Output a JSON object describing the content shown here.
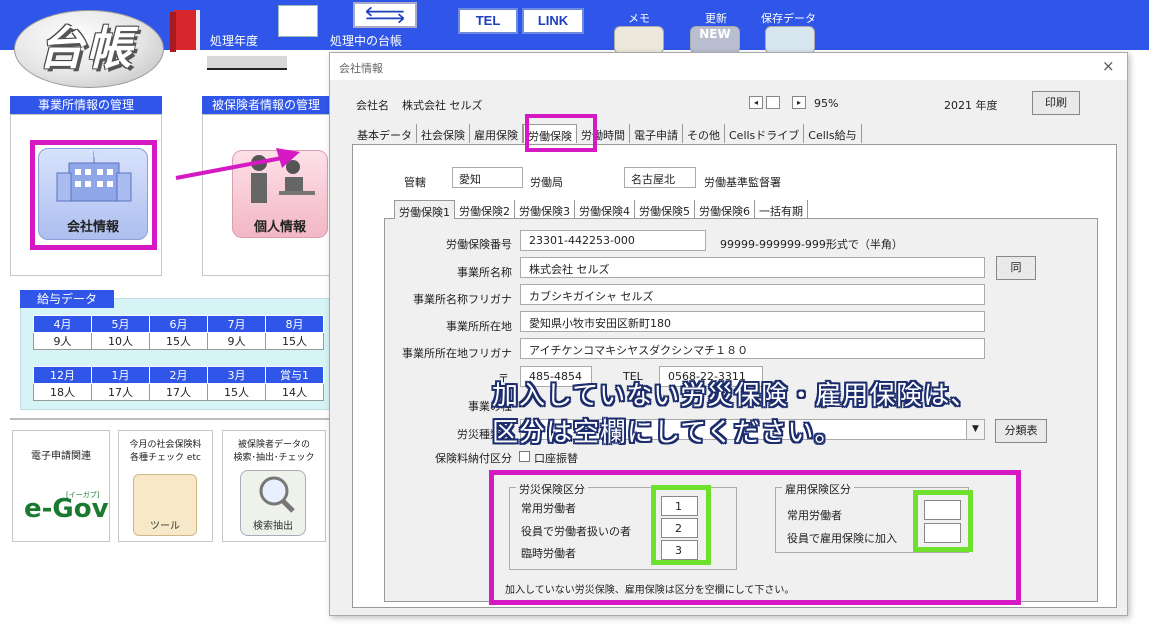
{
  "app": {
    "logo_text": "台帳"
  },
  "toolbar": {
    "year_label": "処理年度",
    "ledger_label": "処理中の台帳",
    "tel": "TEL",
    "link": "LINK",
    "memo": "メモ",
    "update": "更新",
    "update_pic_text": "NEW",
    "save": "保存データ"
  },
  "left": {
    "office_head": "事業所情報の管理",
    "insured_head": "被保険者情報の管理",
    "company_label": "会社情報",
    "personal_label": "個人情報",
    "salary_tab": "給与データ",
    "salary_row1": {
      "months": [
        "4月",
        "5月",
        "6月",
        "7月",
        "8月"
      ],
      "counts": [
        "9人",
        "10人",
        "15人",
        "9人",
        "15人"
      ]
    },
    "salary_row2": {
      "months": [
        "12月",
        "1月",
        "2月",
        "3月",
        "賞与1"
      ],
      "counts": [
        "18人",
        "17人",
        "17人",
        "15人",
        "14人"
      ]
    },
    "tile_eapp": "電子申請関連",
    "tile_monthly": "今月の社会保険料\n各種チェック etc",
    "tile_search": "被保険者データの\n検索･抽出･チェック",
    "egov": "e-Gov",
    "egov_small": "[イーガブ]",
    "tools_label": "ツール",
    "search_label": "検索抽出"
  },
  "dialog": {
    "title": "会社情報",
    "close": "×",
    "company_name_label": "会社名",
    "company_name": "株式会社 セルズ",
    "zoom": "95%",
    "year": "2021 年度",
    "print": "印刷",
    "tabs": [
      "基本データ",
      "社会保険",
      "雇用保険",
      "労働保険",
      "労働時間",
      "電子申請",
      "その他",
      "Cellsドライブ",
      "Cells給与"
    ],
    "active_tab": "労働保険",
    "kankatsu_label": "管轄",
    "kankatsu_value": "愛知",
    "kankatsu_suffix": "労働局",
    "kantoku_value": "名古屋北",
    "kantoku_suffix": "労働基準監督署",
    "sub_tabs": [
      "労働保険1",
      "労働保険2",
      "労働保険3",
      "労働保険4",
      "労働保険5",
      "労働保険6",
      "一括有期"
    ],
    "active_sub_tab": "労働保険1",
    "fields": {
      "hoken_no_label": "労働保険番号",
      "hoken_no": "23301-442253-000",
      "format_note": "99999-999999-999形式で（半角）",
      "name_label": "事業所名称",
      "name": "株式会社 セルズ",
      "same_btn": "同",
      "kana_label": "事業所名称フリガナ",
      "kana": "カブシキガイシャ セルズ",
      "addr_label": "事業所所在地",
      "addr": "愛知県小牧市安田区新町180",
      "addr_kana_label": "事業所所在地フリガナ",
      "addr_kana": "アイチケンコマキシヤスダクシンマチ１８０",
      "postal_mark": "〒",
      "postal": "485-4854",
      "tel_label": "TEL",
      "tel": "0568-22-3311",
      "type_label": "事業の種",
      "kind_label": "労災種類の",
      "kind_value": "",
      "dropdown_arrow": "▼",
      "bunrui_btn": "分類表",
      "pay_label": "保険料納付区分",
      "pay_option": "口座振替"
    },
    "banner_line1": "加入していない労災保険・雇用保険は、",
    "banner_line2": "区分は空欄にしてください。",
    "rousai": {
      "title": "労災保険区分",
      "labels": [
        "常用労働者",
        "役員で労働者扱いの者",
        "臨時労働者"
      ],
      "values": [
        "1",
        "2",
        "3"
      ]
    },
    "koyou": {
      "title": "雇用保険区分",
      "labels": [
        "常用労働者",
        "役員で雇用保険に加入"
      ],
      "values": [
        "",
        ""
      ]
    },
    "note": "加入していない労災保険、雇用保険は区分を空欄にして下さい。"
  },
  "colors": {
    "brand_blue": "#2f56e8",
    "highlight_magenta": "#d51ac4",
    "highlight_green": "#6fe12c"
  }
}
